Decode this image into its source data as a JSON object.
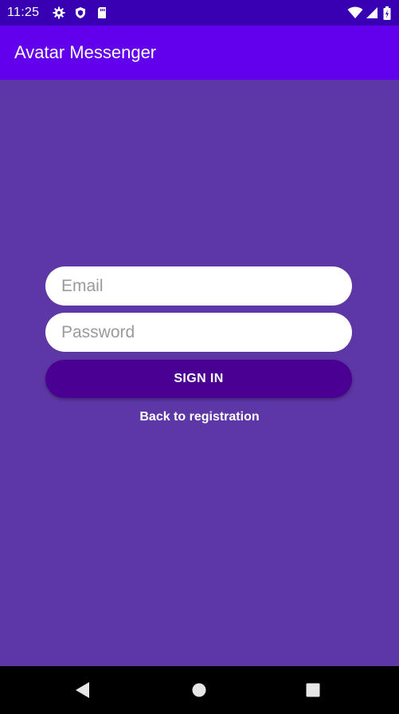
{
  "status_bar": {
    "time": "11:25",
    "icons": [
      "gear-icon",
      "shield-icon",
      "sd-card-icon",
      "wifi-icon",
      "signal-icon",
      "battery-icon"
    ]
  },
  "app_bar": {
    "title": "Avatar Messenger",
    "color": "#6200ee"
  },
  "login_form": {
    "email_placeholder": "Email",
    "email_value": "",
    "password_placeholder": "Password",
    "password_value": "",
    "signin_label": "SIGN IN",
    "back_link_label": "Back to registration"
  },
  "colors": {
    "status_bar": "#3700b3",
    "background": "#5e37a6",
    "button": "#4a0092"
  },
  "nav_bar": {
    "buttons": [
      "back-icon",
      "home-icon",
      "recents-icon"
    ]
  }
}
